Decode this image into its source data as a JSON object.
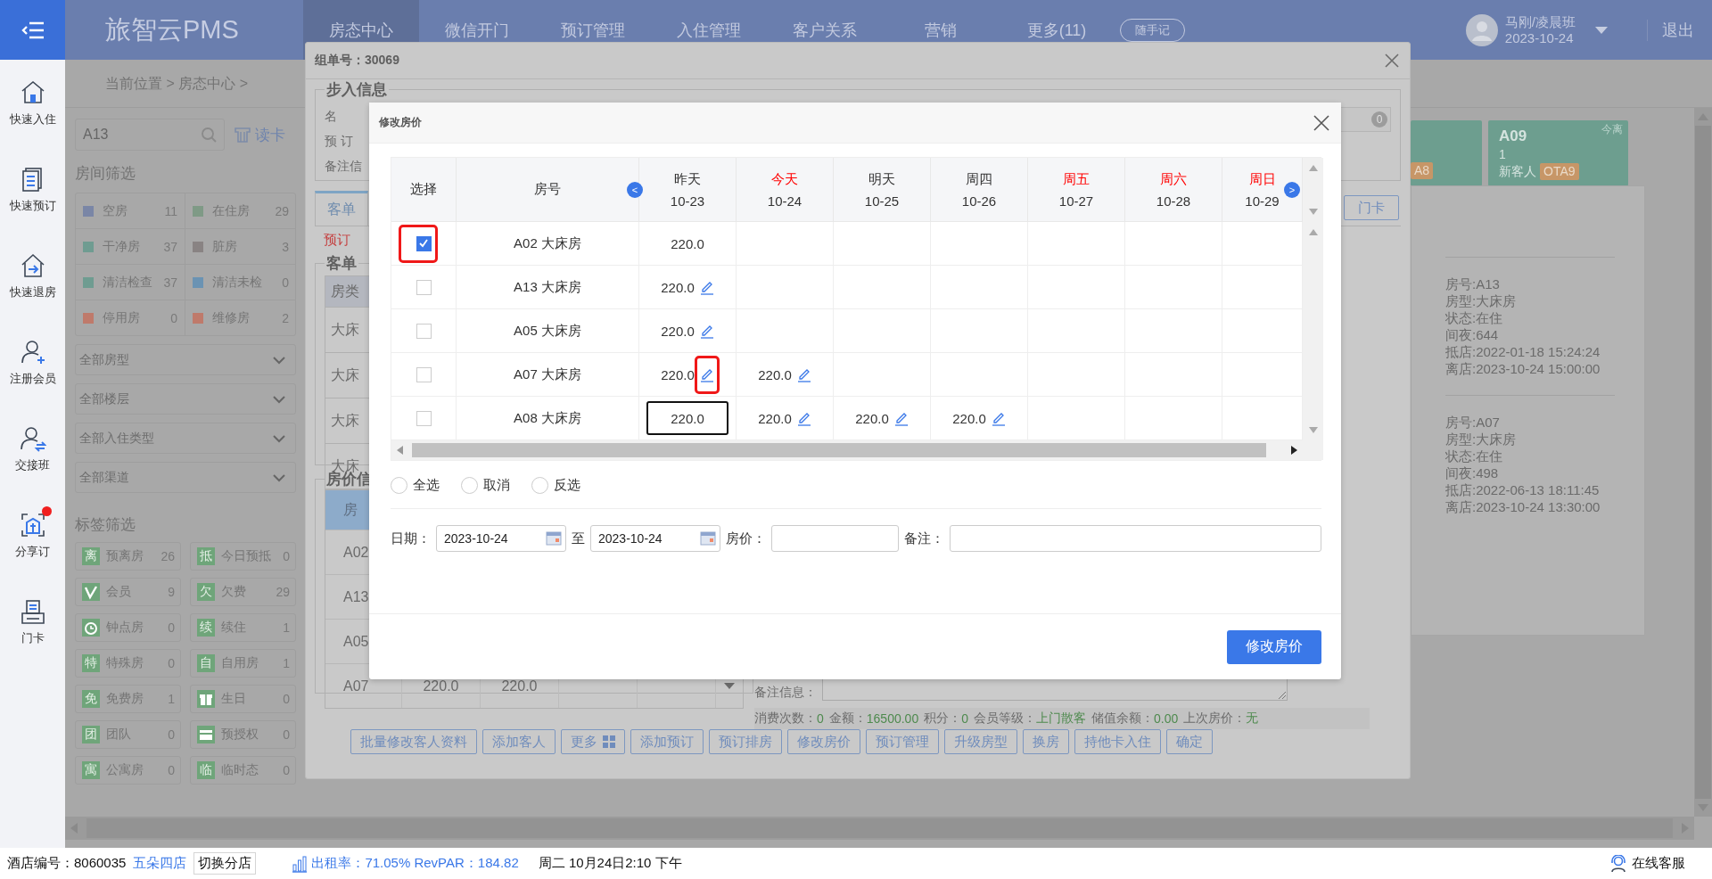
{
  "sidebar": {
    "items": [
      {
        "label": "快速入住",
        "notification": false
      },
      {
        "label": "快速预订",
        "notification": false
      },
      {
        "label": "快速退房",
        "notification": false
      },
      {
        "label": "注册会员",
        "notification": false
      },
      {
        "label": "交接班",
        "notification": false
      },
      {
        "label": "分享订",
        "notification": true
      },
      {
        "label": "门卡",
        "notification": false
      }
    ]
  },
  "top_bar": {
    "logo": "旅智云PMS",
    "nav": [
      {
        "label": "房态中心",
        "selected": true
      },
      {
        "label": "微信开门",
        "selected": false
      },
      {
        "label": "预订管理",
        "selected": false
      },
      {
        "label": "入住管理",
        "selected": false
      },
      {
        "label": "客户关系",
        "selected": false
      },
      {
        "label": "营销",
        "selected": false
      },
      {
        "label": "更多(11)",
        "selected": false
      }
    ],
    "note_button": "随手记",
    "user": {
      "name": "马刚/凌晨班",
      "date": "2023-10-24"
    },
    "logout": "退出"
  },
  "breadcrumb": "当前位置 > 房态中心 >",
  "left_panel": {
    "search": {
      "value": "A13"
    },
    "read_card": "读卡",
    "room_filter": {
      "title": "房间筛选",
      "items": [
        {
          "label": "空房",
          "count": "11",
          "color": "#7a86a6"
        },
        {
          "label": "在住房",
          "count": "29",
          "color": "#7f9a86"
        },
        {
          "label": "干净房",
          "count": "37",
          "color": "#6f9c91"
        },
        {
          "label": "脏房",
          "count": "3",
          "color": "#898383"
        },
        {
          "label": "清洁检查",
          "count": "37",
          "color": "#6f9c91"
        },
        {
          "label": "清洁未检",
          "count": "0",
          "color": "#6b93b3"
        },
        {
          "label": "停用房",
          "count": "0",
          "color": "#bf7a6b"
        },
        {
          "label": "维修房",
          "count": "2",
          "color": "#bf7a6b"
        }
      ]
    },
    "dropdowns": [
      "全部房型",
      "全部楼层",
      "全部入住类型",
      "全部渠道"
    ],
    "tag_filter": {
      "title": "标签筛选",
      "items": [
        {
          "kind": "letter",
          "badge": "离",
          "label": "预离房",
          "count": "26"
        },
        {
          "kind": "letter",
          "badge": "抵",
          "label": "今日预抵",
          "count": "0"
        },
        {
          "kind": "symbol",
          "label": "会员",
          "count": "9"
        },
        {
          "kind": "letter",
          "badge": "欠",
          "label": "欠费",
          "count": "29"
        },
        {
          "kind": "symbol",
          "label": "钟点房",
          "count": "0"
        },
        {
          "kind": "letter",
          "badge": "续",
          "label": "续住",
          "count": "1"
        },
        {
          "kind": "letter",
          "badge": "特",
          "label": "特殊房",
          "count": "0"
        },
        {
          "kind": "letter",
          "badge": "自",
          "label": "自用房",
          "count": "1"
        },
        {
          "kind": "letter",
          "badge": "免",
          "label": "免费房",
          "count": "1"
        },
        {
          "kind": "symbol",
          "label": "生日",
          "count": "0"
        },
        {
          "kind": "letter",
          "badge": "团",
          "label": "团队",
          "count": "0"
        },
        {
          "kind": "symbol",
          "label": "预授权",
          "count": "0"
        },
        {
          "kind": "letter",
          "badge": "寓",
          "label": "公寓房",
          "count": "0"
        },
        {
          "kind": "letter",
          "badge": "临",
          "label": "临时态",
          "count": "0"
        }
      ]
    }
  },
  "room_cards": [
    {
      "badge": "A8"
    },
    {
      "room": "A09",
      "count": "1",
      "guest": "新客人",
      "badge": "OTA9",
      "tag": "今离"
    }
  ],
  "room_popup": {
    "entries": [
      {
        "lines": [
          "房号:A13",
          "房型:大床房",
          "状态:在住",
          "间夜:644",
          "抵店:2022-01-18 15:24:24",
          "离店:2023-10-24 15:00:00"
        ]
      },
      {
        "lines": [
          "房号:A07",
          "房型:大床房",
          "状态:在住",
          "间夜:498",
          "抵店:2022-06-13 18:11:45",
          "离店:2023-10-24 13:30:00"
        ]
      }
    ]
  },
  "order_dialog": {
    "title": "组单号：30069",
    "walk_in": {
      "legend": "步入信息",
      "labels": [
        "名",
        "预 订",
        "备注信"
      ],
      "badge": "0"
    },
    "tabs": [
      {
        "label": "客单",
        "selected": true
      }
    ],
    "door_card_button": "门卡",
    "notice": "预订",
    "guest_list": {
      "legend": "客单",
      "header": "房类",
      "rows": [
        "大床",
        "大床",
        "大床",
        "大床"
      ]
    },
    "rate_info": {
      "legend": "房价信",
      "header": "房",
      "rows": [
        {
          "room": "A02",
          "rates": []
        },
        {
          "room": "A13",
          "rates": []
        },
        {
          "room": "A05",
          "rates": []
        },
        {
          "room": "A07",
          "rates": [
            "220.0",
            "220.0"
          ]
        }
      ]
    },
    "remark_label": "备注信息：",
    "stats": [
      {
        "label": "消费次数：",
        "value": "0"
      },
      {
        "label": "金额：",
        "value": "16500.00"
      },
      {
        "label": "积分：",
        "value": "0"
      },
      {
        "label": "会员等级：",
        "value": "上门散客"
      },
      {
        "label": "储值余额：",
        "value": "0.00"
      },
      {
        "label": "上次房价：",
        "value": "无"
      }
    ],
    "buttons": [
      "批量修改客人资料",
      "添加客人",
      "更多",
      "添加预订",
      "预订排房",
      "修改房价",
      "预订管理",
      "升级房型",
      "换房",
      "持他卡入住",
      "确定"
    ]
  },
  "price_dialog": {
    "title": "修改房价",
    "select_header": "选择",
    "room_header": "房号",
    "prev_button": "<",
    "next_button": ">",
    "dates": [
      {
        "label": "昨天",
        "date": "10-23",
        "highlight": false
      },
      {
        "label": "今天",
        "date": "10-24",
        "highlight": true
      },
      {
        "label": "明天",
        "date": "10-25",
        "highlight": false
      },
      {
        "label": "周四",
        "date": "10-26",
        "highlight": false
      },
      {
        "label": "周五",
        "date": "10-27",
        "highlight": true
      },
      {
        "label": "周六",
        "date": "10-28",
        "highlight": true
      },
      {
        "label": "周日",
        "date": "10-29",
        "highlight": true
      }
    ],
    "rows": [
      {
        "room": "A02 大床房",
        "checked": true,
        "annotated": true,
        "prices": [
          {
            "value": "220.0",
            "editable": false,
            "annotated": false,
            "editing": false
          }
        ]
      },
      {
        "room": "A13 大床房",
        "checked": false,
        "annotated": false,
        "prices": [
          {
            "value": "220.0",
            "editable": true,
            "annotated": false,
            "editing": false
          }
        ]
      },
      {
        "room": "A05 大床房",
        "checked": false,
        "annotated": false,
        "prices": [
          {
            "value": "220.0",
            "editable": true,
            "annotated": false,
            "editing": false
          }
        ]
      },
      {
        "room": "A07 大床房",
        "checked": false,
        "annotated": false,
        "prices": [
          {
            "value": "220.0",
            "editable": true,
            "annotated": true,
            "editing": false
          },
          {
            "value": "220.0",
            "editable": true,
            "annotated": false,
            "editing": false
          }
        ]
      },
      {
        "room": "A08 大床房",
        "checked": false,
        "annotated": false,
        "prices": [
          {
            "value": "220.0",
            "editable": false,
            "annotated": false,
            "editing": true
          },
          {
            "value": "220.0",
            "editable": true,
            "annotated": false,
            "editing": false
          },
          {
            "value": "220.0",
            "editable": true,
            "annotated": false,
            "editing": false
          },
          {
            "value": "220.0",
            "editable": true,
            "annotated": false,
            "editing": false
          }
        ]
      }
    ],
    "radios": [
      {
        "label": "全选",
        "selected": false
      },
      {
        "label": "取消",
        "selected": false
      },
      {
        "label": "反选",
        "selected": false
      }
    ],
    "form": {
      "date_label": "日期：",
      "start_date": "2023-10-24",
      "to_label": "至",
      "end_date": "2023-10-24",
      "price_label": "房价：",
      "remark_label": "备注："
    },
    "submit": "修改房价"
  },
  "status_bar": {
    "hotel": "酒店编号：8060035",
    "branch": "五朵四店",
    "switch_button": "切换分店",
    "occupancy": "出租率：71.05% RevPAR：184.82",
    "datetime": "周二 10月24日2:10 下午",
    "support": "在线客服"
  }
}
